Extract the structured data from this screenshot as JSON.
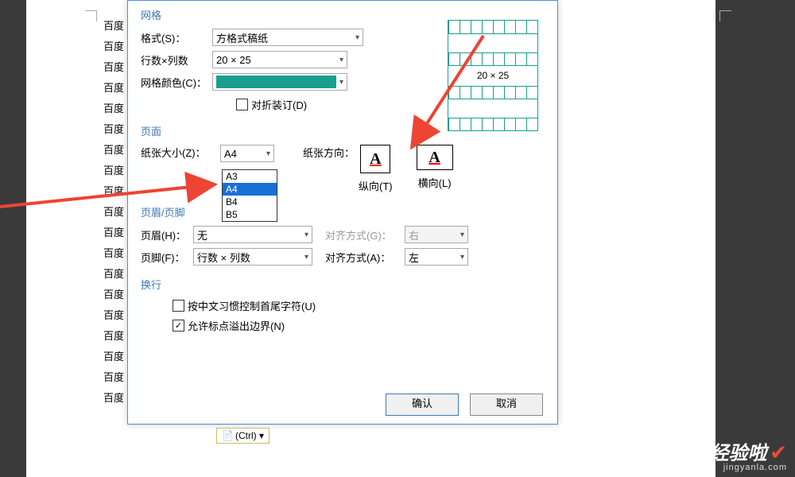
{
  "bg_texts": [
    "百度",
    "百度",
    "百度",
    "百度",
    "百度",
    "百度",
    "百度",
    "百度",
    "百度",
    "百度",
    "百度",
    "百度",
    "百度",
    "百度",
    "百度",
    "百度",
    "百度",
    "百度",
    "百度"
  ],
  "dialog": {
    "grid_section": {
      "title": "网格",
      "format_label": "格式(S)：",
      "format_value": "方格式稿纸",
      "rowcol_label": "行数×列数",
      "rowcol_value": "20 × 25",
      "color_label": "网格颜色(C)：",
      "fold_label": "对折装订(D)",
      "preview_label": "20 × 25"
    },
    "page_section": {
      "title": "页面",
      "size_label": "纸张大小(Z)：",
      "size_value": "A4",
      "size_options": [
        "A3",
        "A4",
        "B4",
        "B5"
      ],
      "orient_label": "纸张方向：",
      "portrait_label": "纵向(T)",
      "landscape_label": "横向(L)"
    },
    "hf_section": {
      "title": "页眉/页脚",
      "header_label": "页眉(H)：",
      "header_value": "无",
      "header_align_label": "对齐方式(G)：",
      "header_align_value": "右",
      "footer_label": "页脚(F)：",
      "footer_value": "行数 × 列数",
      "footer_align_label": "对齐方式(A)：",
      "footer_align_value": "左"
    },
    "wrap_section": {
      "title": "换行",
      "punct_ctrl": "按中文习惯控制首尾字符(U)",
      "overflow": "允许标点溢出边界(N)"
    },
    "ok": "确认",
    "cancel": "取消"
  },
  "ctrl_tag": "(Ctrl) ▾",
  "watermark": {
    "big": "经验啦",
    "small": "jingyanla.com"
  }
}
